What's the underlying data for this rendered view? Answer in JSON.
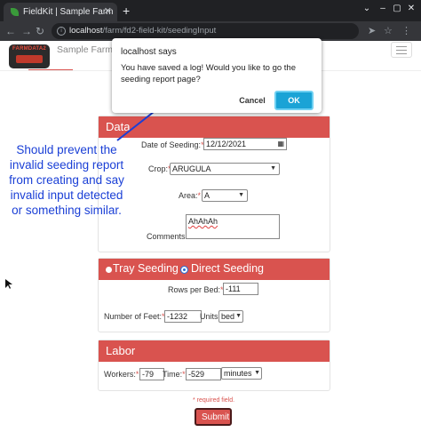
{
  "browser": {
    "tab_title": "FieldKit | Sample Farm",
    "url_host": "localhost",
    "url_path": "/farm/fd2-field-kit/seedingInput"
  },
  "header": {
    "logo_text": "FARMDATA2",
    "farm_name": "Sample Farm"
  },
  "dialog": {
    "title": "localhost says",
    "message": "You have saved a log! Would you like to go the seeding report page?",
    "cancel_label": "Cancel",
    "ok_label": "OK"
  },
  "annotation": {
    "text": "Should prevent the invalid seeding report from creating and say invalid input detected or something similar.",
    "color": "#1a3fd6"
  },
  "data_section": {
    "title": "Data",
    "date_label": "Date of Seeding:",
    "date_value": "12/12/2021",
    "crop_label": "Crop:",
    "crop_value": "ARUGULA",
    "area_label": "Area:",
    "area_value": "A",
    "comments_label": "Comments:",
    "comments_value": "AhAhAh"
  },
  "seeding_type": {
    "tray_label": "Tray Seeding",
    "direct_label": "Direct Seeding",
    "selected": "Direct Seeding",
    "rows_label": "Rows per Bed:",
    "rows_value": "-111",
    "feet_label": "Number of Feet:",
    "feet_value": "-1232",
    "units_label": "Units",
    "units_value": "bed"
  },
  "labor": {
    "title": "Labor",
    "workers_label": "Workers:",
    "workers_value": "-79",
    "time_label": "Time:",
    "time_value": "-529",
    "time_unit": "minutes"
  },
  "required_marker": "*",
  "required_note": "* required field.",
  "submit_label": "Submit",
  "colors": {
    "accent": "#d9534f",
    "ok_button": "#1aa3d6",
    "chrome": "#35363a"
  }
}
